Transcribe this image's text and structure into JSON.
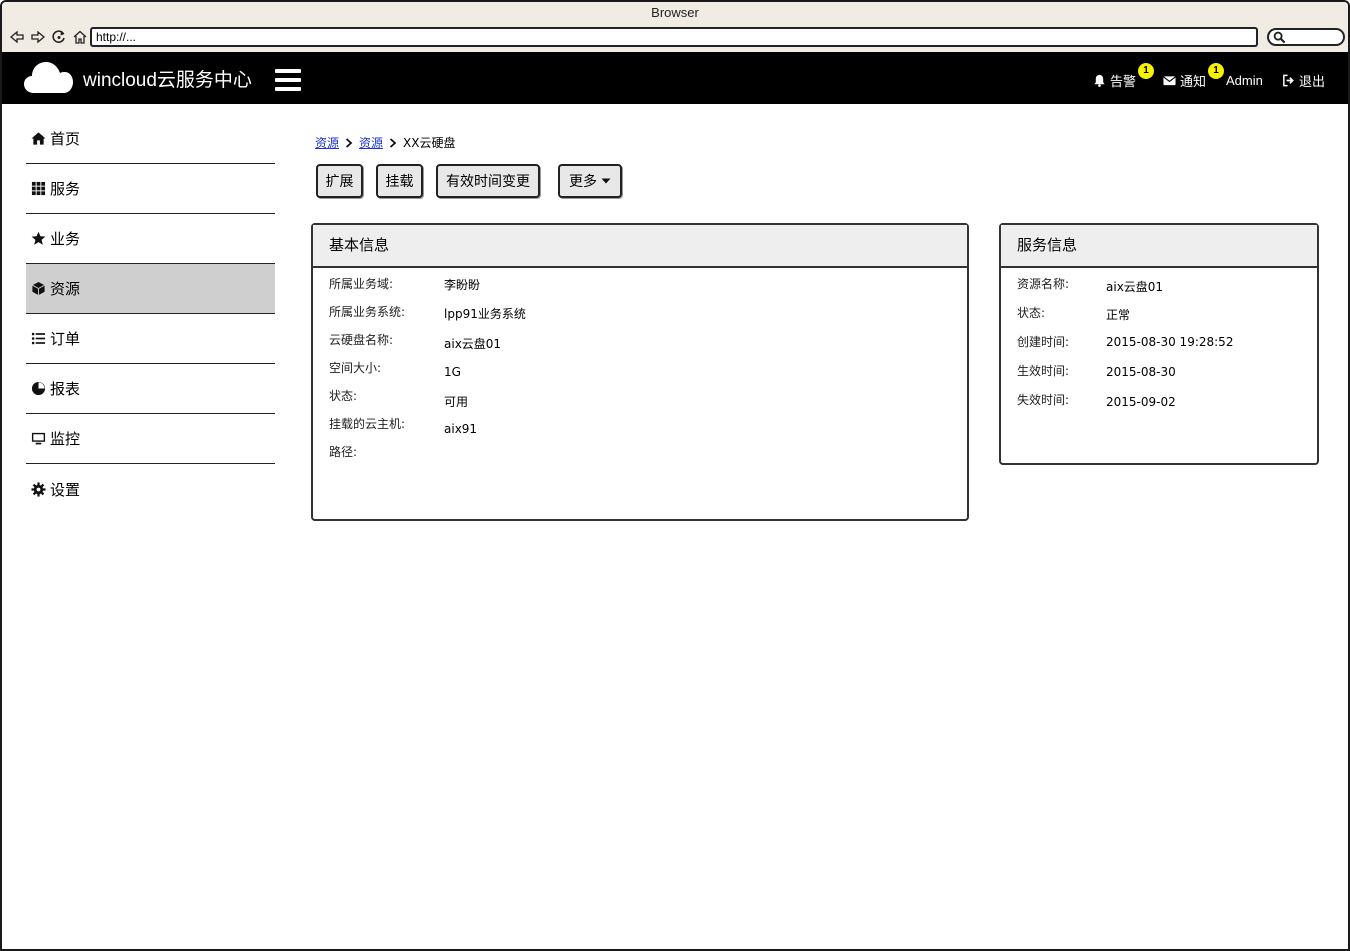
{
  "browser": {
    "title": "Browser",
    "url": "http://..."
  },
  "header": {
    "brand": "wincloud云服务中心",
    "alert_label": "告警",
    "alert_count": "1",
    "notice_label": "通知",
    "notice_count": "1",
    "user": "Admin",
    "logout_label": "退出"
  },
  "sidebar": {
    "items": [
      {
        "label": "首页",
        "icon": "home-icon"
      },
      {
        "label": "服务",
        "icon": "grid-icon"
      },
      {
        "label": "业务",
        "icon": "star-icon"
      },
      {
        "label": "资源",
        "icon": "cube-icon",
        "active": true
      },
      {
        "label": "订单",
        "icon": "list-icon"
      },
      {
        "label": "报表",
        "icon": "pie-chart-icon"
      },
      {
        "label": "监控",
        "icon": "monitor-icon"
      },
      {
        "label": "设置",
        "icon": "gear-icon"
      }
    ]
  },
  "breadcrumb": {
    "items": [
      "资源",
      "资源",
      "XX云硬盘"
    ]
  },
  "actions": {
    "expand": "扩展",
    "mount": "挂载",
    "change_validity": "有效时间变更",
    "more": "更多"
  },
  "basic_info": {
    "title": "基本信息",
    "fields": [
      {
        "label": "所属业务域:",
        "value": "李盼盼"
      },
      {
        "label": "所属业务系统:",
        "value": "lpp91业务系统"
      },
      {
        "label": "云硬盘名称:",
        "value": "aix云盘01"
      },
      {
        "label": "空间大小:",
        "value": "1G"
      },
      {
        "label": "状态:",
        "value": "可用"
      },
      {
        "label": "挂载的云主机:",
        "value": "aix91"
      },
      {
        "label": "路径:",
        "value": ""
      }
    ]
  },
  "service_info": {
    "title": "服务信息",
    "fields": [
      {
        "label": "资源名称:",
        "value": "aix云盘01"
      },
      {
        "label": "状态:",
        "value": "正常"
      },
      {
        "label": "创建时间:",
        "value": "2015-08-30 19:28:52"
      },
      {
        "label": "生效时间:",
        "value": "2015-08-30"
      },
      {
        "label": "失效时间:",
        "value": "2015-09-02"
      }
    ]
  }
}
